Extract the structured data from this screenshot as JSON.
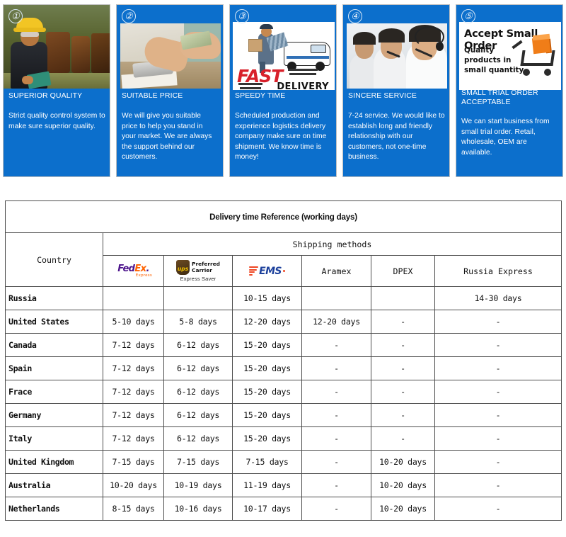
{
  "cards": [
    {
      "number": "①",
      "title": "SUPERIOR QUALITY",
      "body": "Strict quality control system to make sure superior quality.",
      "media": "factory-worker-photo"
    },
    {
      "number": "②",
      "title": "SUITABLE PRICE",
      "body": "We will give you suitable price to help you stand in your market. We are always the support behind our customers.",
      "media": "calculator-money-photo"
    },
    {
      "number": "③",
      "title": "SPEEDY TIME",
      "body": "Scheduled production and experience logistics delivery company make sure on time shipment. We know time is money!",
      "media": "fast-delivery-graphic",
      "graphic_text": {
        "fast": "FAST",
        "delivery": "DELIVERY"
      }
    },
    {
      "number": "④",
      "title": "SINCERE SERVICE",
      "body": "7-24 service. We would like to establish long and friendly relationship with our customers, not one-time business.",
      "media": "call-center-agents-photo"
    },
    {
      "number": "⑤",
      "title": "SMALL TRIAL ORDER ACCEPTABLE",
      "body": "We can start business from small trial order. Retail, wholesale, OEM are available.",
      "media": "accept-small-order-graphic",
      "graphic_text": {
        "headline": "Accept Small Order",
        "subline": "Quality products in small quantity"
      }
    }
  ],
  "table": {
    "title": "Delivery time Reference (working days)",
    "country_header": "Country",
    "shipping_methods_header": "Shipping methods",
    "methods": [
      {
        "name": "FedEx",
        "logo": "fedex-logo",
        "parts": {
          "fed": "Fed",
          "ex": "Ex",
          "sub": "Express"
        }
      },
      {
        "name": "UPS Preferred Carrier",
        "logo": "ups-logo",
        "parts": {
          "mark": "ups",
          "line1": "Preferred",
          "line2": "Carrier",
          "sub": "Express Saver"
        }
      },
      {
        "name": "EMS",
        "logo": "ems-logo",
        "parts": {
          "text": "EMS"
        }
      },
      {
        "name": "Aramex",
        "logo": "text-label"
      },
      {
        "name": "DPEX",
        "logo": "text-label"
      },
      {
        "name": "Russia Express",
        "logo": "text-label"
      }
    ],
    "rows": [
      {
        "country": "Russia",
        "values": [
          "",
          "",
          "10-15 days",
          "",
          "",
          "14-30 days"
        ]
      },
      {
        "country": "United States",
        "values": [
          "5-10 days",
          "5-8 days",
          "12-20 days",
          "12-20 days",
          "-",
          "-"
        ]
      },
      {
        "country": "Canada",
        "values": [
          "7-12 days",
          "6-12 days",
          "15-20 days",
          "-",
          "-",
          "-"
        ]
      },
      {
        "country": "Spain",
        "values": [
          "7-12 days",
          "6-12 days",
          "15-20 days",
          "-",
          "-",
          "-"
        ]
      },
      {
        "country": "Frace",
        "values": [
          "7-12 days",
          "6-12 days",
          "15-20 days",
          "-",
          "-",
          "-"
        ]
      },
      {
        "country": "Germany",
        "values": [
          "7-12 days",
          "6-12 days",
          "15-20 days",
          "-",
          "-",
          "-"
        ]
      },
      {
        "country": "Italy",
        "values": [
          "7-12 days",
          "6-12 days",
          "15-20 days",
          "-",
          "-",
          "-"
        ]
      },
      {
        "country": "United Kingdom",
        "values": [
          "7-15 days",
          "7-15 days",
          "7-15 days",
          "-",
          "10-20 days",
          "-"
        ]
      },
      {
        "country": "Australia",
        "values": [
          "10-20 days",
          "10-19 days",
          "11-19 days",
          "-",
          "10-20 days",
          "-"
        ]
      },
      {
        "country": "Netherlands",
        "values": [
          "8-15 days",
          "10-16 days",
          "10-17 days",
          "-",
          "10-20 days",
          "-"
        ]
      }
    ]
  },
  "colors": {
    "card_blue": "#0c6fcc",
    "title_red": "#e62229",
    "fedex_purple": "#4d148c",
    "fedex_orange": "#ff6200",
    "ems_blue": "#1b3f9b",
    "ems_orange": "#ef4623",
    "ups_gold": "#f2c200",
    "box_orange": "#f07d18"
  }
}
